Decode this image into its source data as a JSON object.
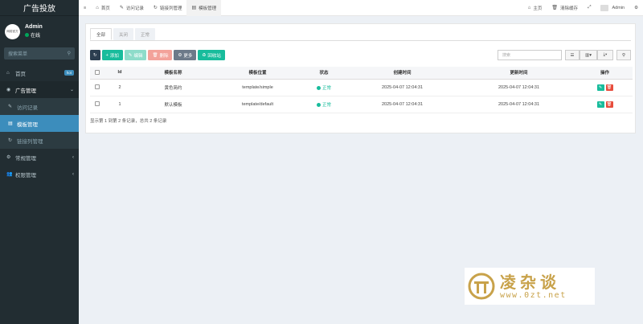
{
  "sidebar": {
    "logo": "广告投放",
    "avatar_text": "网络官方",
    "user_name": "Admin",
    "user_status": "在线",
    "search_placeholder": "搜索菜单",
    "items": [
      {
        "label": "首页",
        "badge": "hot"
      },
      {
        "label": "广告管理"
      },
      {
        "label": "访问记录"
      },
      {
        "label": "模板管理"
      },
      {
        "label": "链接列管理"
      },
      {
        "label": "常规管理"
      },
      {
        "label": "权限管理"
      }
    ]
  },
  "topbar": {
    "tabs": [
      {
        "label": "首页"
      },
      {
        "label": "访问记录"
      },
      {
        "label": "链接列管理"
      },
      {
        "label": "模板管理"
      }
    ],
    "right": {
      "home": "主页",
      "clear_cache": "清除缓存",
      "admin": "Admin"
    }
  },
  "main": {
    "tabs": [
      "全部",
      "关闭",
      "正常"
    ],
    "toolbar": {
      "add": "添加",
      "edit": "编辑",
      "delete": "删除",
      "more": "更多",
      "recycle": "回收站"
    },
    "search_placeholder": "搜索",
    "columns": [
      "Id",
      "模板名称",
      "模板位置",
      "状态",
      "创建时间",
      "更新时间",
      "操作"
    ],
    "rows": [
      {
        "id": "2",
        "name": "黄色简约",
        "path": "template/simple",
        "status": "正常",
        "created": "2025-04-07 12:04:31",
        "updated": "2025-04-07 12:04:31"
      },
      {
        "id": "1",
        "name": "默认模板",
        "path": "template/default",
        "status": "正常",
        "created": "2025-04-07 12:04:31",
        "updated": "2025-04-07 12:04:31"
      }
    ],
    "pager": "显示第 1 到第 2 条记录，总共 2 条记录"
  },
  "watermark": {
    "cn": "凌杂谈",
    "url": "www.0zt.net"
  },
  "colors": {
    "sidebar": "#222d32",
    "active": "#3c8dbc",
    "success": "#18bc9c",
    "danger": "#e74c3c"
  }
}
